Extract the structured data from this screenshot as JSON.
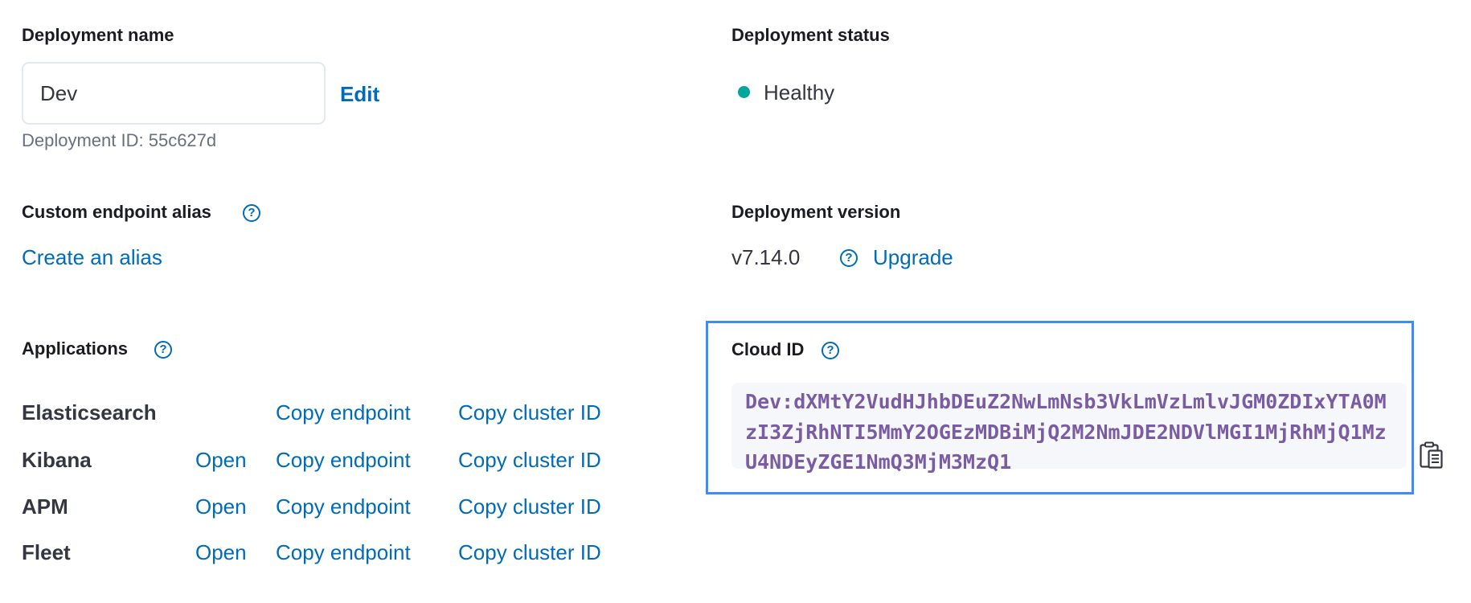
{
  "deployment_name": {
    "label": "Deployment name",
    "value": "Dev",
    "edit_label": "Edit",
    "deployment_id_text": "Deployment ID: 55c627d"
  },
  "deployment_status": {
    "label": "Deployment status",
    "value": "Healthy",
    "color": "#00a69b"
  },
  "custom_endpoint_alias": {
    "label": "Custom endpoint alias",
    "help_icon": "question-circle-icon",
    "create_link": "Create an alias"
  },
  "deployment_version": {
    "label": "Deployment version",
    "version": "v7.14.0",
    "help_icon": "question-circle-icon",
    "upgrade_link": "Upgrade"
  },
  "applications": {
    "label": "Applications",
    "help_icon": "question-circle-icon",
    "rows": [
      {
        "name": "Elasticsearch",
        "open": null,
        "copy_endpoint": "Copy endpoint",
        "copy_cluster_id": "Copy cluster ID"
      },
      {
        "name": "Kibana",
        "open": "Open",
        "copy_endpoint": "Copy endpoint",
        "copy_cluster_id": "Copy cluster ID"
      },
      {
        "name": "APM",
        "open": "Open",
        "copy_endpoint": "Copy endpoint",
        "copy_cluster_id": "Copy cluster ID"
      },
      {
        "name": "Fleet",
        "open": "Open",
        "copy_endpoint": "Copy endpoint",
        "copy_cluster_id": "Copy cluster ID"
      }
    ]
  },
  "cloud_id": {
    "label": "Cloud ID",
    "help_icon": "question-circle-icon",
    "lines": [
      "Dev:dXMtY2VudHJhbDEuZ2NwLmNsb3VkLmVzLmlvJGM0ZDIxYTA0M",
      "zI3ZjRhNTI5MmY2OGEzMDBiMjQ2M2NmJDE2NDVlMGI1MjRhMjQ1Mz",
      "U4NDEyZGE1NmQ3MjM3MzQ1"
    ],
    "copy_icon": "clipboard-icon"
  },
  "colors": {
    "link": "#006bb8",
    "focus_border": "#3f8cf2",
    "code_text": "#7a5ca3",
    "healthy": "#00a69b"
  }
}
